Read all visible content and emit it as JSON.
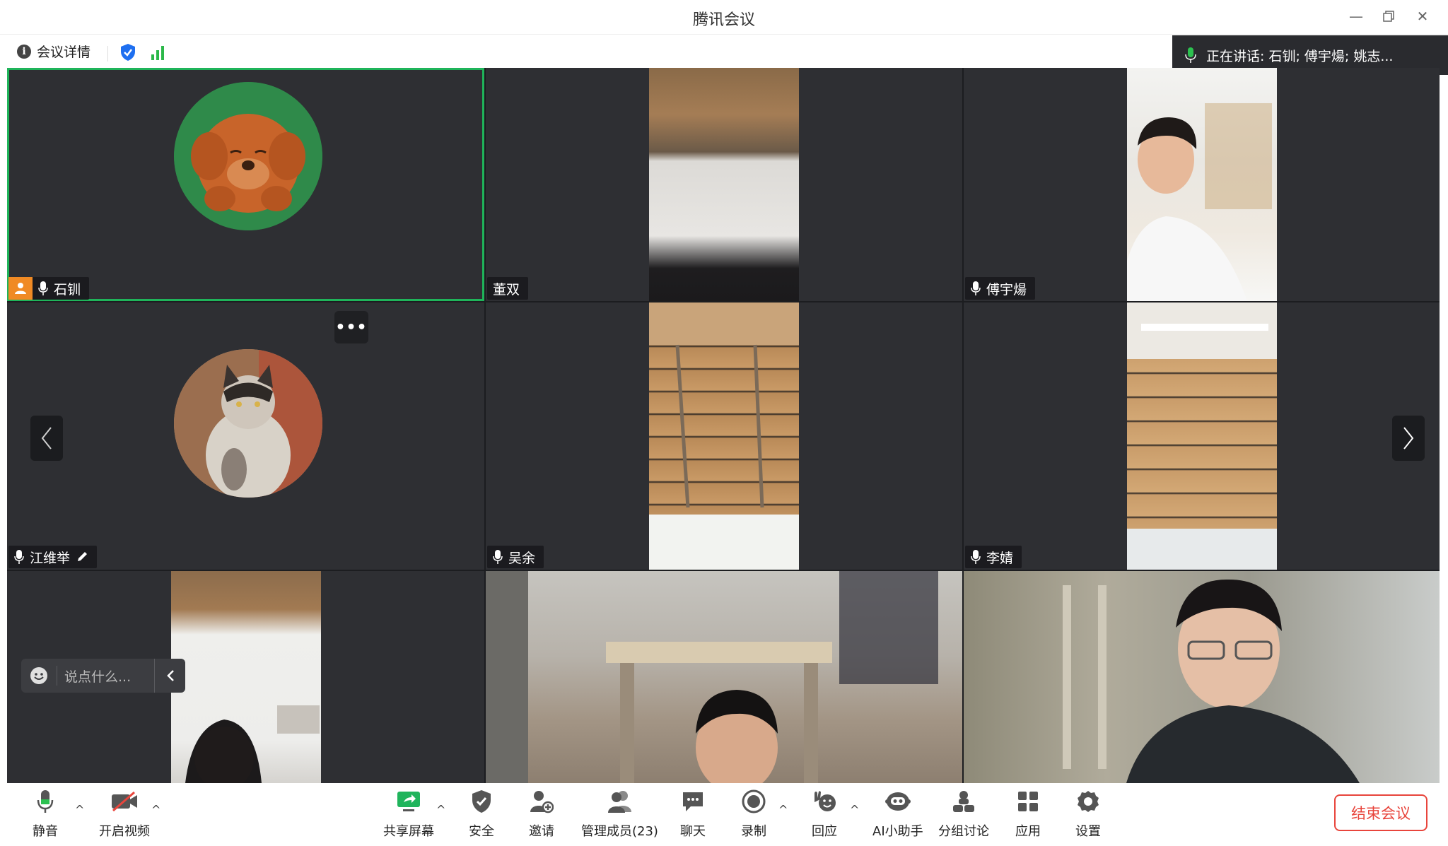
{
  "window": {
    "title": "腾讯会议",
    "controls": [
      "minimize",
      "restore",
      "close"
    ]
  },
  "infobar": {
    "details_label": "会议详情",
    "security_icon": "shield-check-icon",
    "network_icon": "signal-bars-icon"
  },
  "speaking": {
    "text": "正在讲话:  石钏; 傅宇煬; 姚志..."
  },
  "participants": [
    {
      "name": "石钏",
      "video": false,
      "avatar": "bear",
      "host": true,
      "active": true,
      "mic": true
    },
    {
      "name": "董双",
      "video": true,
      "mic": false
    },
    {
      "name": "傅宇煬",
      "video": true,
      "mic": true
    },
    {
      "name": "江维举",
      "video": false,
      "avatar": "cat",
      "mic": true,
      "editable": true
    },
    {
      "name": "吴余",
      "video": true,
      "mic": true
    },
    {
      "name": "李婧",
      "video": true,
      "mic": true
    },
    {
      "name": "",
      "video": true
    },
    {
      "name": "",
      "video": true
    },
    {
      "name": "",
      "video": true
    }
  ],
  "chat": {
    "placeholder": "说点什么..."
  },
  "toolbar": {
    "mute": "静音",
    "video": "开启视频",
    "share": "共享屏幕",
    "security": "安全",
    "invite": "邀请",
    "members": "管理成员(23)",
    "chat": "聊天",
    "record": "录制",
    "react": "回应",
    "ai": "AI小助手",
    "breakout": "分组讨论",
    "apps": "应用",
    "settings": "设置",
    "end": "结束会议"
  },
  "colors": {
    "accent_green": "#1fb45a",
    "end_red": "#e8453c",
    "host_orange": "#f08a24",
    "tile_bg": "#2e2f33"
  }
}
